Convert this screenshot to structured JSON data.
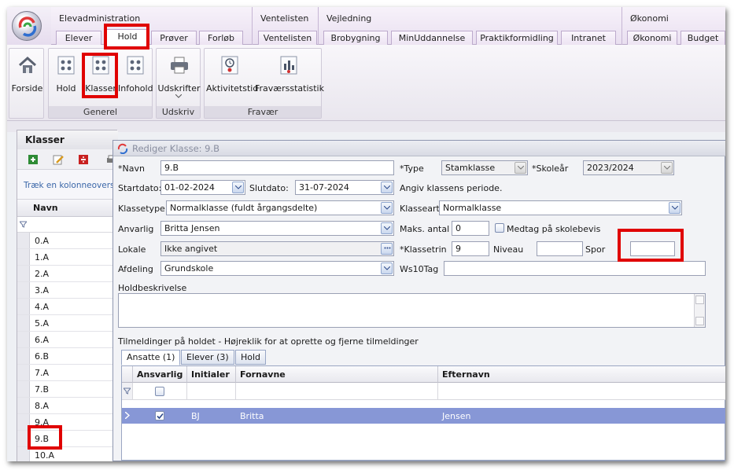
{
  "ribbon": {
    "groups": [
      {
        "title": "Elevadministration"
      },
      {
        "title": "Ventelisten"
      },
      {
        "title": "Vejledning"
      },
      {
        "title": "Økonomi"
      }
    ],
    "tabs": [
      "Elever",
      "Hold",
      "Prøver",
      "Forløb",
      "Ventelisten",
      "Brobygning",
      "MinUddannelse",
      "Praktikformidling",
      "Intranet",
      "Økonomi",
      "Budget"
    ],
    "active_tab": "Hold",
    "buttons": {
      "forside": "Forside",
      "hold": "Hold",
      "klasser": "Klasser",
      "infohold": "Infohold",
      "udskrifter": "Udskrifter",
      "aktivitetstid": "Aktivitetstid",
      "fravaersstatistik": "Fraværsstatistik"
    },
    "group_labels": {
      "generel": "Generel",
      "udskriv": "Udskriv",
      "fravaer": "Fravær"
    }
  },
  "left_panel": {
    "title": "Klasser",
    "hint": "Træk en kolonneoverskrift",
    "column": "Navn",
    "rows": [
      "0.A",
      "1.A",
      "2.A",
      "3.A",
      "4.A",
      "5.A",
      "6.A",
      "6.B",
      "7.A",
      "7.B",
      "8.A",
      "9.A",
      "9.B",
      "10.A"
    ],
    "selected": "9.B"
  },
  "dialog": {
    "title": "Rediger Klasse: 9.B",
    "labels": {
      "navn": "*Navn",
      "type": "*Type",
      "skolear": "*Skoleår",
      "startdato": "Startdato:",
      "slutdato": "Slutdato:",
      "periode_hint": "Angiv klassens periode.",
      "klassetype": "Klassetype",
      "klasseart": "Klasseart",
      "ansvarlig": "Anvarlig",
      "maks_antal": "Maks. antal",
      "medtag": "Medtag på skolebevis",
      "lokale": "Lokale",
      "klassetrin": "*Klassetrin",
      "niveau": "Niveau",
      "spor": "Spor",
      "afdeling": "Afdeling",
      "ws10tag": "Ws10Tag",
      "holdbeskrivelse": "Holdbeskrivelse",
      "tilmeldinger": "Tilmeldinger på holdet - Højreklik for at oprette og fjerne tilmeldinger"
    },
    "values": {
      "navn": "9.B",
      "type": "Stamklasse",
      "skolear": "2023/2024",
      "startdato": "01-02-2024",
      "slutdato": "31-07-2024",
      "klassetype": "Normalklasse (fuldt årgangsdelte)",
      "klasseart": "Normalklasse",
      "ansvarlig": "Britta Jensen",
      "maks_antal": "0",
      "lokale": "Ikke angivet",
      "klassetrin": "9",
      "niveau": "",
      "spor": "",
      "afdeling": "Grundskole",
      "ws10tag": "",
      "holdbeskrivelse": ""
    },
    "subtabs": [
      "Ansatte (1)",
      "Elever (3)",
      "Hold"
    ],
    "grid": {
      "columns": [
        "Ansvarlig",
        "Initialer",
        "Fornavne",
        "Efternavn"
      ],
      "rows": [
        {
          "ansvarlig": true,
          "initialer": "BJ",
          "fornavne": "Britta",
          "efternavn": "Jensen"
        }
      ]
    }
  },
  "colors": {
    "highlight": "#e00000",
    "selected_row": "#8797d6",
    "ribbon_bg": "#ece2f2"
  }
}
